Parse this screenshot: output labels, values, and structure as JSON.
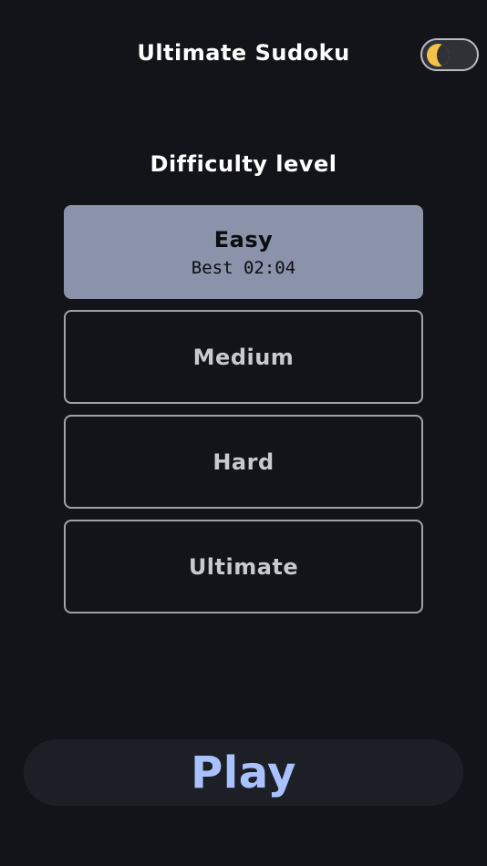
{
  "header": {
    "title": "Ultimate Sudoku",
    "theme_toggle_icon": "moon-icon",
    "theme_toggle_color": "#f2c24a"
  },
  "difficulty": {
    "heading": "Difficulty level",
    "options": [
      {
        "label": "Easy",
        "best": "Best 02:04",
        "selected": true
      },
      {
        "label": "Medium",
        "selected": false
      },
      {
        "label": "Hard",
        "selected": false
      },
      {
        "label": "Ultimate",
        "selected": false
      }
    ]
  },
  "actions": {
    "play_label": "Play"
  },
  "colors": {
    "background": "#131419",
    "selected_option": "#8a93aa",
    "play_text": "#a9c2ff",
    "play_button": "#1c1f25"
  }
}
